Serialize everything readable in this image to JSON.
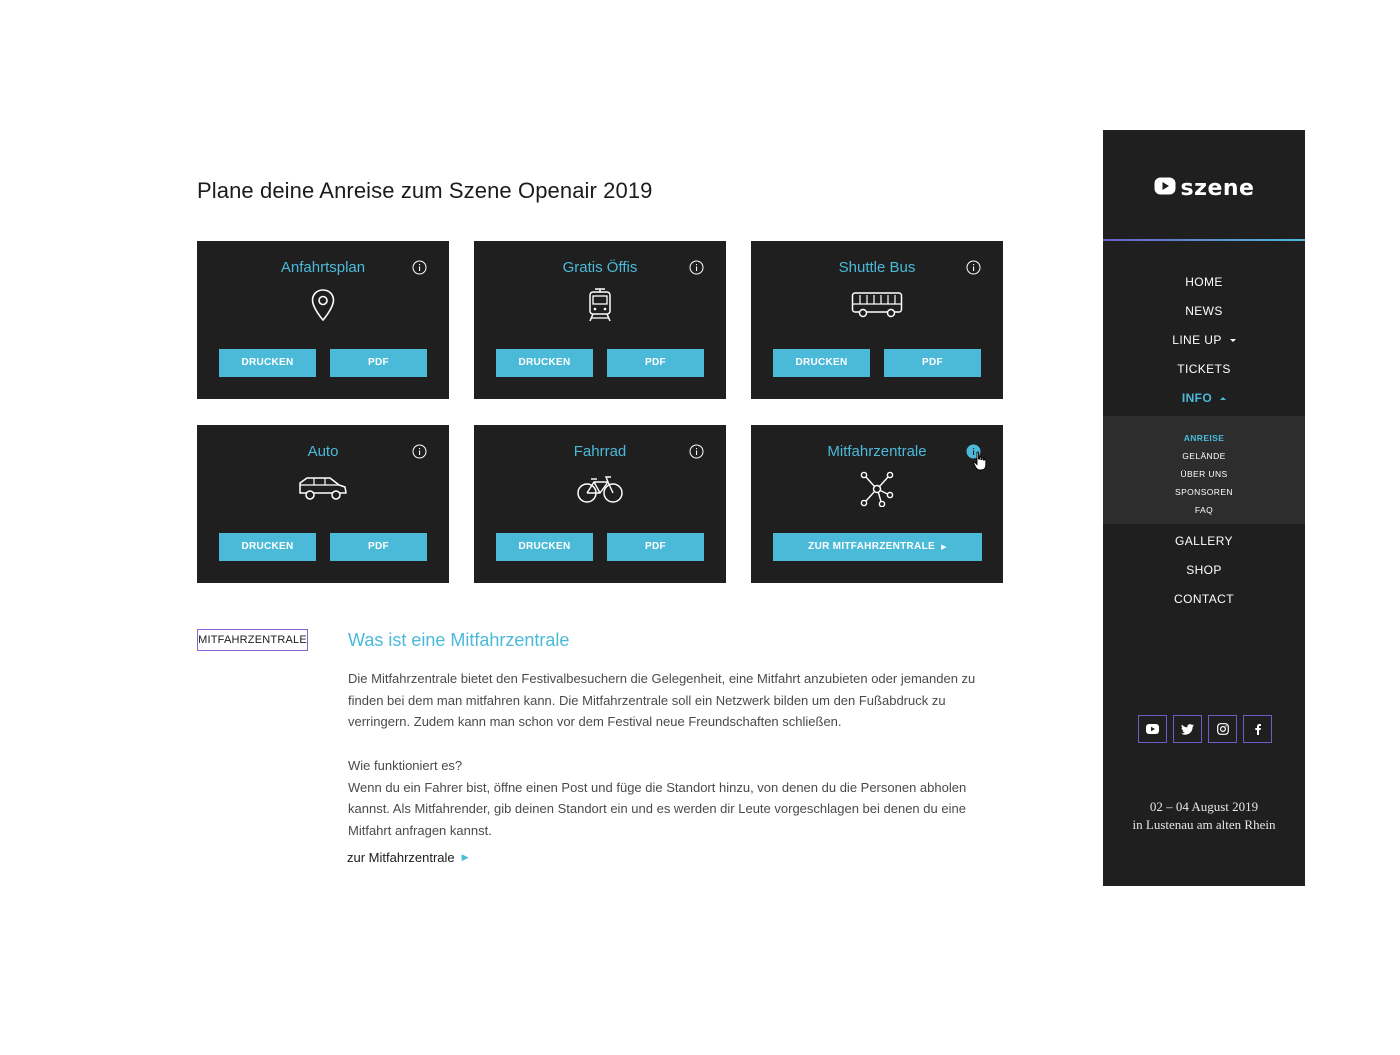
{
  "page": {
    "title": "Plane deine Anreise zum Szene Openair 2019"
  },
  "cards": [
    {
      "title": "Anfahrtsplan",
      "icon": "map-pin-icon",
      "buttons": [
        "DRUCKEN",
        "PDF"
      ]
    },
    {
      "title": "Gratis Öffis",
      "icon": "tram-icon",
      "buttons": [
        "DRUCKEN",
        "PDF"
      ]
    },
    {
      "title": "Shuttle Bus",
      "icon": "bus-icon",
      "buttons": [
        "DRUCKEN",
        "PDF"
      ]
    },
    {
      "title": "Auto",
      "icon": "car-icon",
      "buttons": [
        "DRUCKEN",
        "PDF"
      ]
    },
    {
      "title": "Fahrrad",
      "icon": "bicycle-icon",
      "buttons": [
        "DRUCKEN",
        "PDF"
      ]
    },
    {
      "title": "Mitfahrzentrale",
      "icon": "network-icon",
      "buttons": [
        "ZUR MITFAHRZENTRALE"
      ]
    }
  ],
  "section": {
    "tag": "MITFAHRZENTRALE",
    "heading": "Was ist eine Mitfahrzentrale",
    "paragraph1": "Die Mitfahrzentrale bietet den Festivalbesuchern die Gelegenheit, eine Mitfahrt anzubieten oder jemanden zu finden bei dem man mitfahren kann. Die Mitfahrzentrale soll ein Netzwerk bilden um den Fußabdruck zu verringern. Zudem kann man schon vor dem Festival neue Freundschaften schließen.",
    "question": "Wie funktioniert es?",
    "paragraph2": "Wenn du ein Fahrer bist, öffne einen Post und füge die Standort hinzu, von denen du die Personen abholen kannst. Als Mitfahrender, gib deinen Standort ein und es werden dir Leute vorgeschlagen bei denen du eine Mitfahrt anfragen kannst.",
    "link": "zur Mitfahrzentrale"
  },
  "sidebar": {
    "logo": "szene",
    "nav": [
      {
        "label": "HOME"
      },
      {
        "label": "NEWS"
      },
      {
        "label": "LINE UP"
      },
      {
        "label": "TICKETS"
      },
      {
        "label": "INFO"
      }
    ],
    "subnav": [
      {
        "label": "ANREISE"
      },
      {
        "label": "GELÄNDE"
      },
      {
        "label": "ÜBER UNS"
      },
      {
        "label": "SPONSOREN"
      },
      {
        "label": "FAQ"
      }
    ],
    "nav_bottom": [
      {
        "label": "GALLERY"
      },
      {
        "label": "SHOP"
      },
      {
        "label": "CONTACT"
      }
    ],
    "socials": [
      "youtube-icon",
      "twitter-icon",
      "instagram-icon",
      "facebook-icon"
    ],
    "date": "02 – 04 August 2019",
    "location": "in Lustenau am alten Rhein"
  },
  "colors": {
    "accent": "#4bbad9",
    "panel": "#1f1f20",
    "subpanel": "#2d2d2e",
    "purple": "#6b5fc7"
  }
}
